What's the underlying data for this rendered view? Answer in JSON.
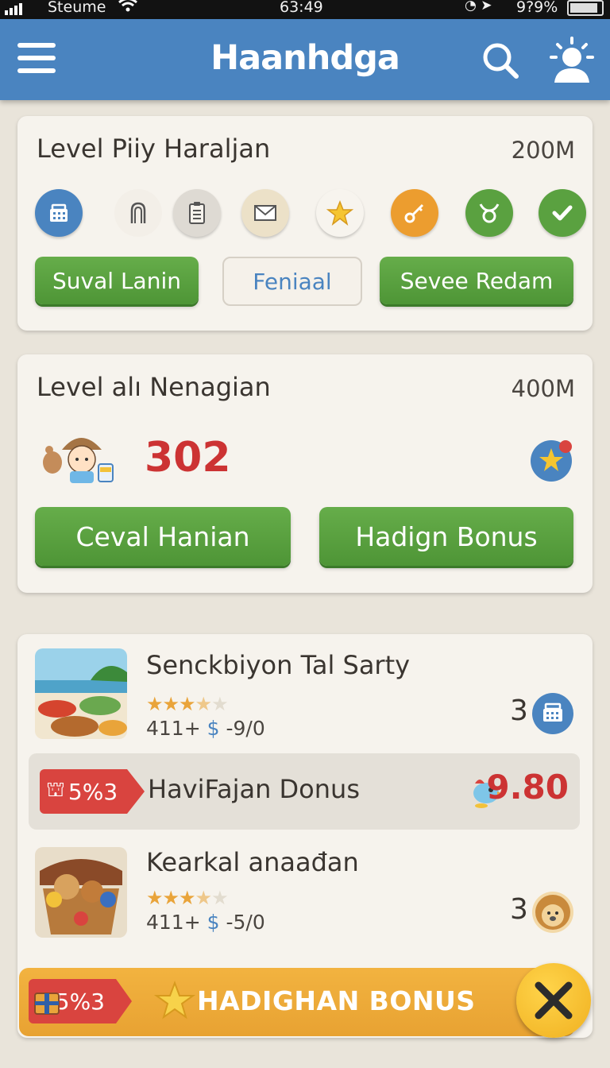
{
  "status_bar": {
    "carrier": "Steume",
    "time": "63:49",
    "battery": "9?9%"
  },
  "app_bar": {
    "title": "Haanhdga"
  },
  "card1": {
    "title": "Level Piiy Haraljan",
    "amount": "200M",
    "icons": [
      "basket-icon",
      "door-icon",
      "clipboard-icon",
      "mail-icon",
      "star-icon",
      "key-icon",
      "taurus-icon",
      "check-icon"
    ],
    "buttons": {
      "left": "Suval Lanin",
      "middle": "Feniaal",
      "right": "Sevee Redam"
    }
  },
  "card2": {
    "title": "Level alı Nenagian",
    "amount": "400M",
    "score": "302",
    "buttons": {
      "left": "Ceval Hanian",
      "right": "Hadign Bonus"
    }
  },
  "list": {
    "items": [
      {
        "title": "Senckbiyon Tal Sarty",
        "rating": 3.5,
        "meta_prefix": "411+",
        "meta_currency": "$",
        "meta_suffix": "-9/0",
        "qty": "3"
      },
      {
        "title": "Kearkal anaađan",
        "rating": 3.5,
        "meta_prefix": "411+",
        "meta_currency": "$",
        "meta_suffix": "-5/0",
        "qty": "3"
      }
    ],
    "bonus_row": {
      "tag": "5%3",
      "label": "HaviFajan Donus",
      "price": "9.80"
    },
    "bonus_bar": {
      "tag": "5%3",
      "label": "HADIGHAN BONUS"
    }
  },
  "colors": {
    "header_blue": "#4a84c0",
    "button_green": "#5aa140",
    "price_red": "#cc3333",
    "bonus_orange": "#f0aa36"
  }
}
